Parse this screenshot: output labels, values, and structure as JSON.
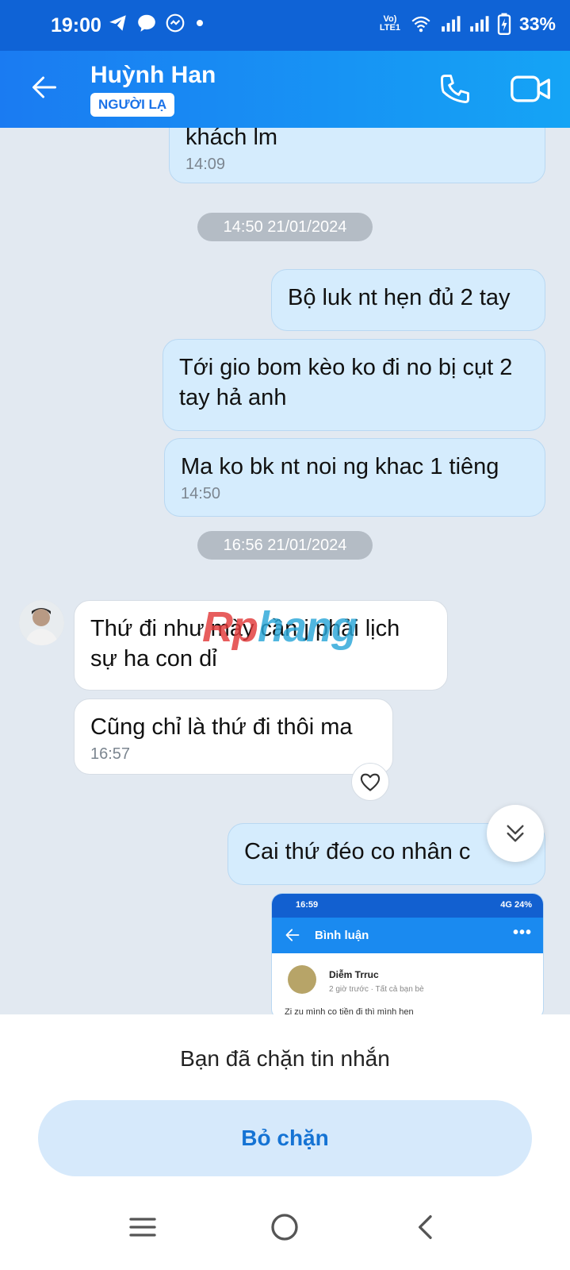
{
  "status_bar": {
    "time": "19:00",
    "network_label": "Vo) LTE1",
    "battery": "33%"
  },
  "header": {
    "contact_name": "Huỳnh Han",
    "badge": "NGƯỜI LẠ"
  },
  "messages": [
    {
      "dir": "out",
      "text": "khách lm",
      "time": "14:09"
    },
    {
      "separator": "14:50 21/01/2024"
    },
    {
      "dir": "out",
      "text": "Bộ luk nt hẹn đủ 2 tay"
    },
    {
      "dir": "out",
      "text": "Tới gio bom kèo ko đi no bị cụt 2 tay hả anh"
    },
    {
      "dir": "out",
      "text": "Ma ko bk nt noi ng khac 1 tiêng",
      "time": "14:50"
    },
    {
      "separator": "16:56 21/01/2024"
    },
    {
      "dir": "in",
      "text": "Thứ đi như mày cần j phải lịch sự ha con dỉ"
    },
    {
      "dir": "in",
      "text": "Cũng chỉ là thứ đi thôi ma",
      "time": "16:57"
    },
    {
      "dir": "out",
      "text": "Cai thứ đéo co nhân c"
    }
  ],
  "watermark": {
    "part1": "Rp",
    "part2": "hang"
  },
  "shared_screenshot": {
    "time": "16:59",
    "status_right": "4G 24%",
    "title": "Bình luận",
    "more": "•••",
    "poster_name": "Diễm Trruc",
    "meta": "2 giờ trước · Tất cả bạn bè",
    "snippet": "Zi zu mình co tiền đi thì mình hẹn"
  },
  "bottom": {
    "blocked_text": "Bạn đã chặn tin nhắn",
    "unblock_label": "Bỏ chặn"
  }
}
